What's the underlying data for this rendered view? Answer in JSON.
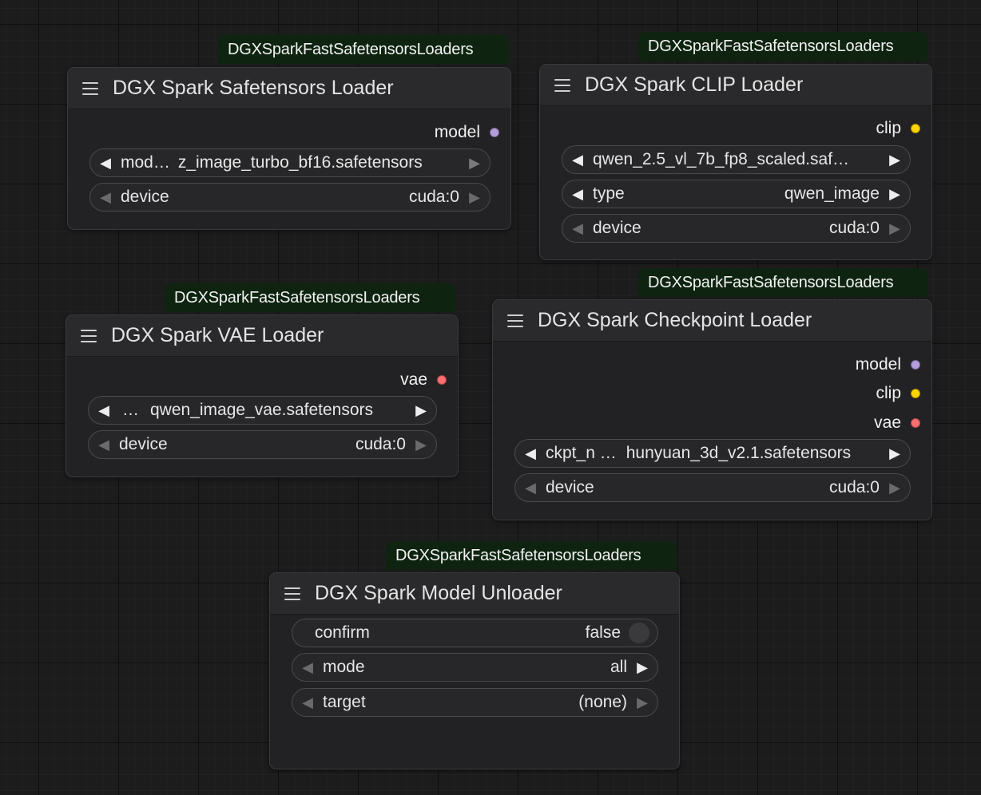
{
  "colors": {
    "model": "#b39ddb",
    "clip": "#ffd500",
    "vae": "#ff6e6e",
    "badge_bg": "#0e2410"
  },
  "nodes": [
    {
      "badge": "DGXSparkFastSafetensorsLoaders",
      "title": "DGX Spark Safetensors Loader",
      "outputs": [
        "model"
      ],
      "widgets": [
        {
          "label": "mod…",
          "value": "z_image_turbo_bf16.safetensors"
        },
        {
          "label": "device",
          "value": "cuda:0"
        }
      ]
    },
    {
      "badge": "DGXSparkFastSafetensorsLoaders",
      "title": "DGX Spark CLIP Loader",
      "outputs": [
        "clip"
      ],
      "widgets": [
        {
          "value": "qwen_2.5_vl_7b_fp8_scaled.saf…"
        },
        {
          "label": "type",
          "value": "qwen_image"
        },
        {
          "label": "device",
          "value": "cuda:0"
        }
      ]
    },
    {
      "badge": "DGXSparkFastSafetensorsLoaders",
      "title": "DGX Spark VAE Loader",
      "outputs": [
        "vae"
      ],
      "widgets": [
        {
          "label": "…",
          "value": "qwen_image_vae.safetensors"
        },
        {
          "label": "device",
          "value": "cuda:0"
        }
      ]
    },
    {
      "badge": "DGXSparkFastSafetensorsLoaders",
      "title": "DGX Spark Checkpoint Loader",
      "outputs": [
        "model",
        "clip",
        "vae"
      ],
      "widgets": [
        {
          "label": "ckpt_n …",
          "value": "hunyuan_3d_v2.1.safetensors"
        },
        {
          "label": "device",
          "value": "cuda:0"
        }
      ]
    },
    {
      "badge": "DGXSparkFastSafetensorsLoaders",
      "title": "DGX Spark Model Unloader",
      "outputs": [],
      "widgets": [
        {
          "label": "confirm",
          "value": "false"
        },
        {
          "label": "mode",
          "value": "all"
        },
        {
          "label": "target",
          "value": "(none)"
        }
      ]
    }
  ]
}
